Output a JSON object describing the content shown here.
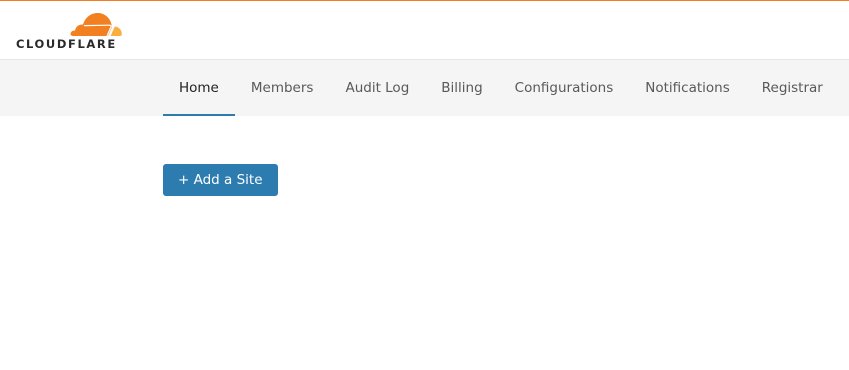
{
  "brand": {
    "name": "CLOUDFLARE",
    "accent_color": "#f38020",
    "cloud_icon": "cloudflare-cloud-icon"
  },
  "nav": {
    "active": "Home",
    "accent_color": "#2c7cb0",
    "tabs": [
      {
        "label": "Home"
      },
      {
        "label": "Members"
      },
      {
        "label": "Audit Log"
      },
      {
        "label": "Billing"
      },
      {
        "label": "Configurations"
      },
      {
        "label": "Notifications"
      },
      {
        "label": "Registrar"
      }
    ]
  },
  "main": {
    "add_site_label": "+ Add a Site",
    "button_color": "#2c7cb0"
  }
}
